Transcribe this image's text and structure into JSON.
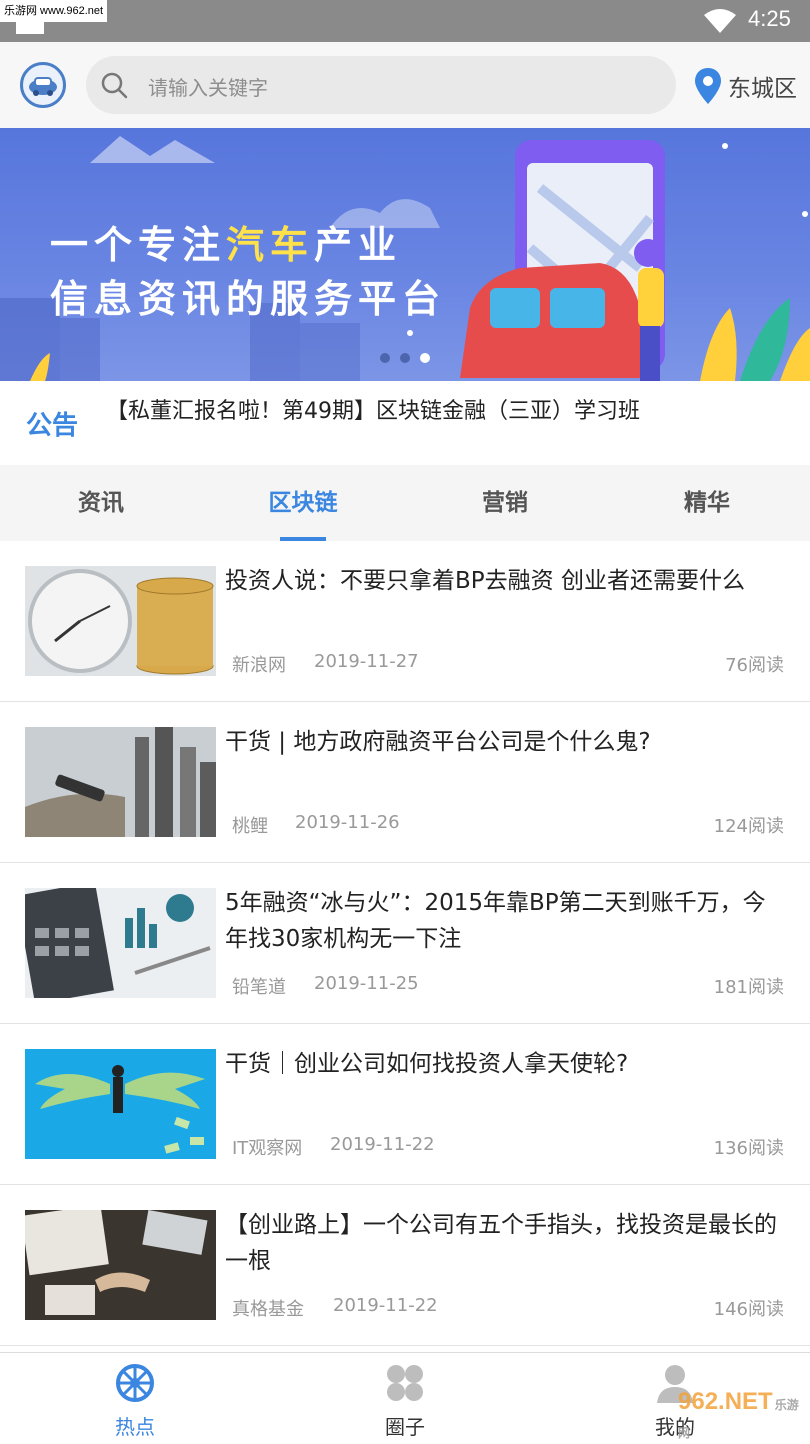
{
  "statusbar": {
    "watermark": "乐游网 www.962.net",
    "time": "4:25"
  },
  "header": {
    "search_placeholder": "请输入关键字",
    "location": "东城区"
  },
  "banner": {
    "line1_a": "一个专注",
    "line1_hl": "汽车",
    "line1_b": "产业",
    "line2": "信息资讯的服务平台"
  },
  "notice": {
    "tag": "公告",
    "text": "【私董汇报名啦！第49期】区块链金融（三亚）学习班"
  },
  "tabs": [
    {
      "label": "资讯"
    },
    {
      "label": "区块链"
    },
    {
      "label": "营销"
    },
    {
      "label": "精华"
    }
  ],
  "articles": [
    {
      "title": "投资人说：不要只拿着BP去融资 创业者还需要什么",
      "source": "新浪网",
      "date": "2019-11-27",
      "reads": "76阅读"
    },
    {
      "title": "干货 | 地方政府融资平台公司是个什么鬼?",
      "source": "桃鲤",
      "date": "2019-11-26",
      "reads": "124阅读"
    },
    {
      "title": "5年融资“冰与火”：2015年靠BP第二天到账千万，今年找30家机构无一下注",
      "source": "铅笔道",
      "date": "2019-11-25",
      "reads": "181阅读"
    },
    {
      "title": "干货｜创业公司如何找投资人拿天使轮?",
      "source": "IT观察网",
      "date": "2019-11-22",
      "reads": "136阅读"
    },
    {
      "title": "【创业路上】一个公司有五个手指头，找投资是最长的一根",
      "source": "真格基金",
      "date": "2019-11-22",
      "reads": "146阅读"
    }
  ],
  "bottom_nav": [
    {
      "label": "热点"
    },
    {
      "label": "圈子"
    },
    {
      "label": "我的"
    }
  ],
  "brand_watermark": {
    "main": "962.NET",
    "sub": "乐游网"
  },
  "colors": {
    "accent": "#3a86e0",
    "banner": "#5f7ddf"
  },
  "icons": {
    "search": "search-icon",
    "location": "location-pin-icon",
    "hot": "wheel-icon",
    "circle": "clover-icon",
    "me": "person-icon"
  }
}
